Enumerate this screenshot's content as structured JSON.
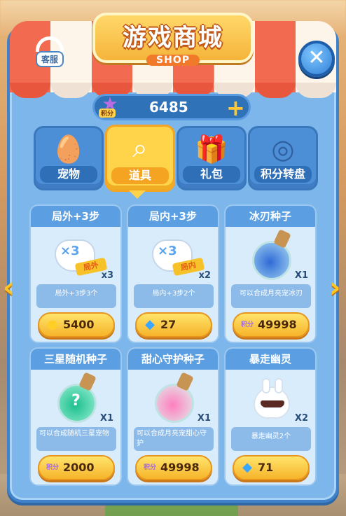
{
  "header": {
    "title": "游戏商城",
    "subtitle": "SHOP",
    "service_label": "客服",
    "close_symbol": "✕"
  },
  "points": {
    "badge": "积分",
    "value": "6485",
    "add_symbol": "+"
  },
  "tabs": [
    {
      "label": "宠物",
      "icon": "pet-icon",
      "active": false
    },
    {
      "label": "道具",
      "icon": "magnifier-icon",
      "active": true
    },
    {
      "label": "礼包",
      "icon": "gift-icon",
      "active": false
    },
    {
      "label": "积分转盘",
      "icon": "wheel-icon",
      "active": false
    }
  ],
  "items": [
    {
      "title": "局外+3步",
      "qty": "x3",
      "desc": "局外+3步3个",
      "price": "5400",
      "currency": "coin",
      "image": "glove-out",
      "band": "局外"
    },
    {
      "title": "局内+3步",
      "qty": "x2",
      "desc": "局内+3步2个",
      "price": "27",
      "currency": "diamond",
      "image": "glove-in",
      "band": "局内"
    },
    {
      "title": "冰刃种子",
      "qty": "X1",
      "desc": "可以合成月亮宠冰刃",
      "price": "49998",
      "currency": "points",
      "image": "potion-blue"
    },
    {
      "title": "三星随机种子",
      "qty": "X1",
      "desc": "可以合成随机三星宠物",
      "price": "2000",
      "currency": "points",
      "image": "potion-green"
    },
    {
      "title": "甜心守护种子",
      "qty": "X1",
      "desc": "可以合成月亮宠甜心守护",
      "price": "49998",
      "currency": "points",
      "image": "potion-pink"
    },
    {
      "title": "暴走幽灵",
      "qty": "X2",
      "desc": "暴走幽灵2个",
      "price": "71",
      "currency": "diamond",
      "image": "ghost"
    }
  ],
  "nav": {
    "left": "‹",
    "right": "›"
  },
  "icons": {
    "glove_x3": "×3",
    "question_mark": "?",
    "coin": "●",
    "diamond": "◆",
    "points_tag": "积分"
  },
  "colors": {
    "panel": "#7cb6ea",
    "active_tab": "#ffd34a",
    "price_button": "#f6b42a",
    "awning_red": "#f26a4f"
  }
}
